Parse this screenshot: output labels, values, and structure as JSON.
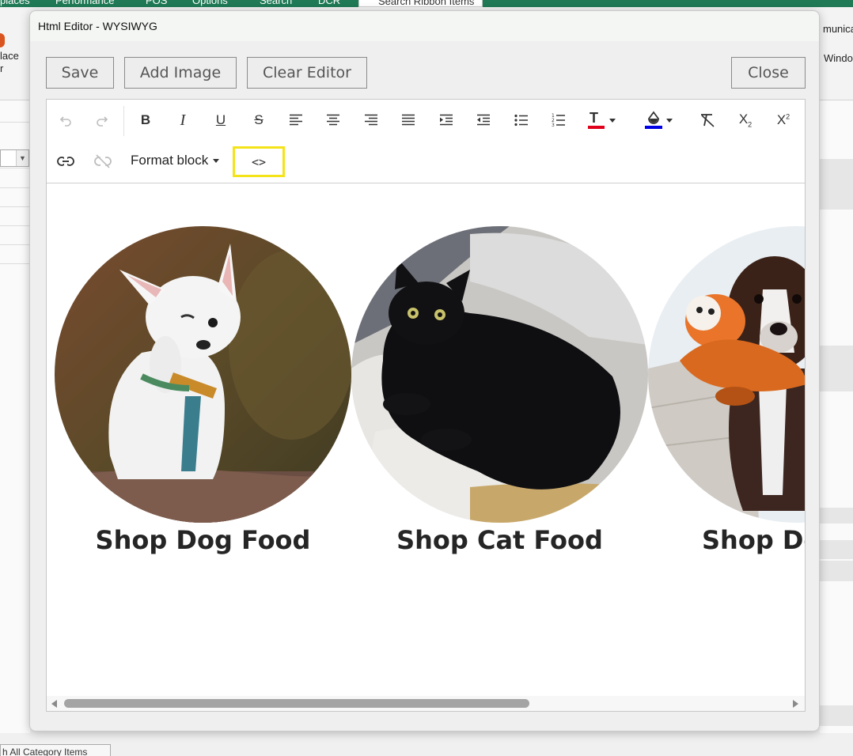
{
  "background_app": {
    "ribbon_tabs": [
      "places",
      "Performance",
      "POS",
      "Options",
      "Search",
      "DCR",
      "Search Ribbon Items"
    ],
    "left_ribbon_label": "lace\nr",
    "right_ribbon_labels": [
      "munica",
      "Windo"
    ],
    "bottom_tab_label": "h All Category Items",
    "accent_color": "#1f7a55"
  },
  "dialog": {
    "title": "Html Editor - WYSIWYG",
    "buttons": {
      "save": "Save",
      "add_image": "Add Image",
      "clear_editor": "Clear Editor",
      "close": "Close"
    }
  },
  "toolbar": {
    "row1": [
      {
        "name": "undo-icon",
        "glyph": "↶",
        "enabled": false
      },
      {
        "name": "redo-icon",
        "glyph": "↷",
        "enabled": false
      },
      {
        "name": "bold-icon",
        "glyph": "B",
        "enabled": true
      },
      {
        "name": "italic-icon",
        "glyph": "I",
        "enabled": true
      },
      {
        "name": "underline-icon",
        "glyph": "U",
        "enabled": true
      },
      {
        "name": "strikethrough-icon",
        "glyph": "S",
        "enabled": true
      },
      {
        "name": "align-left-icon",
        "glyph": "≡",
        "enabled": true
      },
      {
        "name": "align-center-icon",
        "glyph": "≡",
        "enabled": true
      },
      {
        "name": "align-right-icon",
        "glyph": "≡",
        "enabled": true
      },
      {
        "name": "align-justify-icon",
        "glyph": "≡",
        "enabled": true
      },
      {
        "name": "indent-icon",
        "glyph": "⇥",
        "enabled": true
      },
      {
        "name": "outdent-icon",
        "glyph": "⇤",
        "enabled": true
      },
      {
        "name": "bullet-list-icon",
        "glyph": "•",
        "enabled": true
      },
      {
        "name": "numbered-list-icon",
        "glyph": "1.",
        "enabled": true
      },
      {
        "name": "text-color-icon",
        "glyph": "T",
        "enabled": true
      },
      {
        "name": "highlight-color-icon",
        "glyph": "◆",
        "enabled": true
      },
      {
        "name": "clear-format-icon",
        "glyph": "T̸",
        "enabled": true
      },
      {
        "name": "subscript-icon",
        "glyph": "X₂",
        "enabled": true
      },
      {
        "name": "superscript-icon",
        "glyph": "X²",
        "enabled": true
      }
    ],
    "text_color": "#e0001b",
    "highlight_color": "#0000e6",
    "format_block_label": "Format block",
    "source_code_glyph": "<>",
    "source_highlight_color": "#f5e31a"
  },
  "content": {
    "cards": [
      {
        "caption": "Shop Dog Food",
        "subject": "white chihuahua photo"
      },
      {
        "caption": "Shop Cat Food",
        "subject": "black cat photo"
      },
      {
        "caption": "Shop Do",
        "subject": "dog with plush toy photo"
      }
    ]
  },
  "scrollbar": {
    "position_fraction": 0.0,
    "visible_fraction": 0.64
  }
}
